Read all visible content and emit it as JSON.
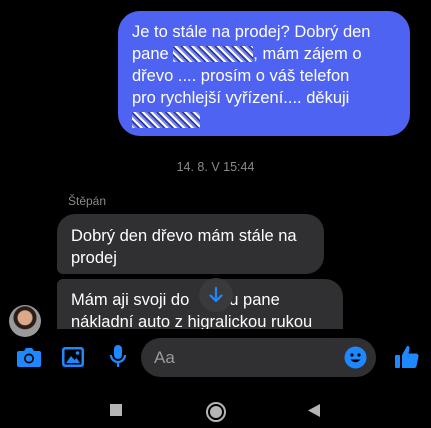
{
  "outgoing_message": {
    "line1": "Je to stále na prodej? Dobrý den",
    "line2_pre": "pane ",
    "line2_post": ", mám zájem o",
    "line3": "dřevo .... prosím o váš telefon",
    "line4": "pro rychlejší vyřízení.... děkuji"
  },
  "timestamp": "14. 8. V 15:44",
  "sender_name": "Štěpán",
  "incoming_messages": [
    {
      "text": "Dobrý den dřevo mám stále na prodej"
    },
    {
      "line1": "Mám aji svoji do",
      "line1_end": "u pane",
      "line2": "nákladní auto z higralickou rukou"
    }
  ],
  "composer": {
    "placeholder": "Aa",
    "accent_color": "#1e88ff"
  },
  "icons": [
    "camera-icon",
    "gallery-icon",
    "microphone-icon",
    "emoji-icon",
    "like-icon",
    "scroll-down-icon",
    "nav-recents-icon",
    "nav-home-icon",
    "nav-back-icon"
  ]
}
